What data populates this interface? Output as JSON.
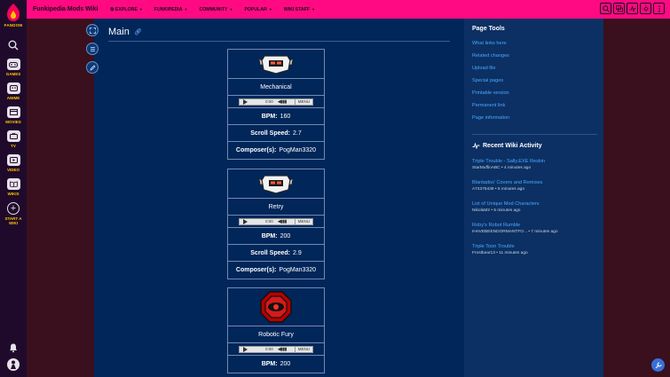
{
  "rail": {
    "logo_label": "FANDOM",
    "items": [
      {
        "label": "GAMES",
        "icon": "gamepad-icon"
      },
      {
        "label": "ANIME",
        "icon": "anime-icon"
      },
      {
        "label": "MOVIES",
        "icon": "movies-icon"
      },
      {
        "label": "TV",
        "icon": "tv-icon"
      },
      {
        "label": "VIDEO",
        "icon": "video-icon"
      },
      {
        "label": "WIKIS",
        "icon": "wikis-icon"
      }
    ],
    "start_wiki_line1": "START A",
    "start_wiki_line2": "WIKI"
  },
  "topbar": {
    "wiki_name": "Funkipedia Mods Wiki",
    "nav": [
      "EXPLORE",
      "FUNKIPEDIA",
      "COMMUNITY",
      "POPULAR",
      "WIKI STAFF"
    ],
    "color": "#ff0a82"
  },
  "page": {
    "title": "Main"
  },
  "infoboxes": [
    {
      "name": "Mechanical",
      "bpm": "160",
      "scroll_speed": "2.7",
      "composer": "PogMan3320",
      "time": "0:00",
      "menu": "MENU"
    },
    {
      "name": "Retry",
      "bpm": "200",
      "scroll_speed": "2.9",
      "composer": "PogMan3320",
      "time": "0:00",
      "menu": "MENU"
    },
    {
      "name": "Robotic Fury",
      "bpm": "200",
      "time": "0:00",
      "menu": "MENU"
    }
  ],
  "labels": {
    "bpm": "BPM:",
    "scroll_speed": "Scroll Speed:",
    "composer": "Composer(s):"
  },
  "page_tools": {
    "title": "Page Tools",
    "links": [
      "What links here",
      "Related changes",
      "Upload file",
      "Special pages",
      "Printable version",
      "Permanent link",
      "Page information"
    ]
  },
  "recent_activity": {
    "title": "Recent Wiki Activity",
    "items": [
      {
        "title": "Triple Trouble - Sally.EXE Reskin",
        "meta": "StarMuffinABC • 4 minutes ago"
      },
      {
        "title": "Blantados' Covers and Remixes",
        "meta": "A74375438 • 5 minutes ago"
      },
      {
        "title": "List of Unique Mod Characters",
        "meta": "NikolaM2 • 5 minutes ago"
      },
      {
        "title": "Roby's Robot Rumble",
        "meta": "IHAVEBEENDORMANTFO... • 7 minutes ago"
      },
      {
        "title": "Triple Toon Trouble",
        "meta": "Frostbear13 • 11 minutes ago"
      }
    ]
  }
}
